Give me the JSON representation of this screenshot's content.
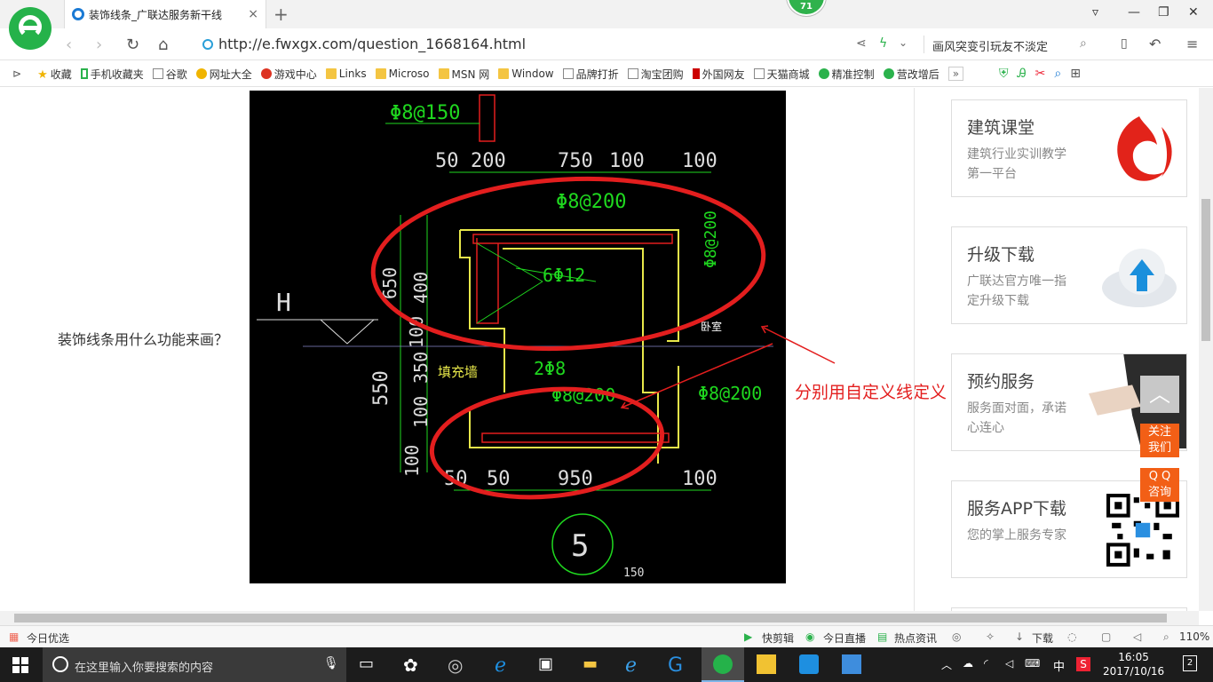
{
  "browser": {
    "tab_title": "装饰线条_广联达服务新干线",
    "tab_close": "×",
    "new_tab": "+",
    "badge_count": "71",
    "url": "http://e.fwxgx.com/question_1668164.html",
    "search_text": "画风突变引玩友不淡定",
    "win_controls": [
      "▿",
      "—",
      "❐",
      "✕"
    ]
  },
  "bookmarks": [
    {
      "label": "收藏",
      "icon": "star-icon"
    },
    {
      "label": "手机收藏夹",
      "icon": "phone-icon"
    },
    {
      "label": "谷歌",
      "icon": "page-icon"
    },
    {
      "label": "网址大全",
      "icon": "site-icon"
    },
    {
      "label": "游戏中心",
      "icon": "game-icon"
    },
    {
      "label": "Links",
      "icon": "folder-icon"
    },
    {
      "label": "Microso",
      "icon": "folder-icon"
    },
    {
      "label": "MSN 网",
      "icon": "folder-icon"
    },
    {
      "label": "Window",
      "icon": "folder-icon"
    },
    {
      "label": "品牌打折",
      "icon": "page-icon"
    },
    {
      "label": "淘宝团购",
      "icon": "page-icon"
    },
    {
      "label": "外国网友",
      "icon": "page-icon"
    },
    {
      "label": "天猫商城",
      "icon": "page-icon"
    },
    {
      "label": "精准控制",
      "icon": "wechat-icon"
    },
    {
      "label": "营改增后",
      "icon": "wechat-icon"
    }
  ],
  "bookmarks_more": "»",
  "question": {
    "text": "装饰线条用什么功能来画？"
  },
  "drawing": {
    "dims_top": [
      "50",
      "200",
      "750",
      "100",
      "100"
    ],
    "dims_bottom": [
      "50",
      "50",
      "950",
      "100"
    ],
    "left_dims": [
      "650",
      "400",
      "100",
      "350",
      "100",
      "550",
      "100"
    ],
    "rebar_labels": [
      "Φ8@150",
      "Φ8@200",
      "6Φ12",
      "Φ8@200",
      "2Φ8",
      "Φ8@200",
      "Φ8@200"
    ],
    "room_label": "卧室",
    "fill_wall_label": "填充墙",
    "elev_label": "H",
    "section_no": "5",
    "scale_no": "150",
    "annotation": "分别用自定义线定义"
  },
  "sidebar": {
    "cards": [
      {
        "title": "建筑课堂",
        "desc": "建筑行业实训教学第一平台"
      },
      {
        "title": "升级下载",
        "desc": "广联达官方唯一指定升级下载"
      },
      {
        "title": "预约服务",
        "desc": "服务面对面，承诺心连心"
      },
      {
        "title": "服务APP下载",
        "desc": "您的掌上服务专家"
      }
    ],
    "back_top": "︿",
    "follow_us": "关注\n我们",
    "qq_consult": "Q Q\n咨询"
  },
  "statusbar": {
    "left": "今日优选",
    "items": [
      "快剪辑",
      "今日直播",
      "热点资讯",
      "下载"
    ],
    "zoom": "110%"
  },
  "taskbar": {
    "search_placeholder": "在这里输入你要搜索的内容",
    "ime": "中",
    "time": "16:05",
    "date": "2017/10/16",
    "notify_count": "2"
  },
  "colors": {
    "brand_green": "#25b24a",
    "annotation_red": "#e31e1e",
    "cad_green": "#1fd81f",
    "cad_yellow": "#e8e84a",
    "orange": "#f25f16"
  }
}
